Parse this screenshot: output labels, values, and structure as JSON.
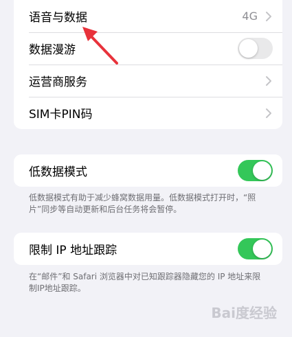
{
  "cellular": {
    "items": [
      {
        "label": "语音与数据",
        "value": "4G"
      },
      {
        "label": "数据漫游",
        "toggle": "off"
      },
      {
        "label": "运营商服务"
      },
      {
        "label": "SIM卡PIN码"
      }
    ]
  },
  "low_data": {
    "label": "低数据模式",
    "toggle": "on",
    "footnote": "低数据模式有助于减少蜂窝数据用量。低数据模式打开时，“照片”同步等自动更新和后台任务将会暂停。"
  },
  "ip_tracking": {
    "label": "限制 IP 地址跟踪",
    "toggle": "on",
    "footnote": "在“邮件”和 Safari 浏览器中对已知跟踪器隐藏您的 IP 地址来限制IP地址跟踪。"
  },
  "colors": {
    "toggle_on": "#34c759",
    "toggle_off": "#e9e9ea",
    "background": "#f2f2f7",
    "arrow": "#e8323b"
  },
  "watermark": {
    "text": "Bai度经验"
  }
}
